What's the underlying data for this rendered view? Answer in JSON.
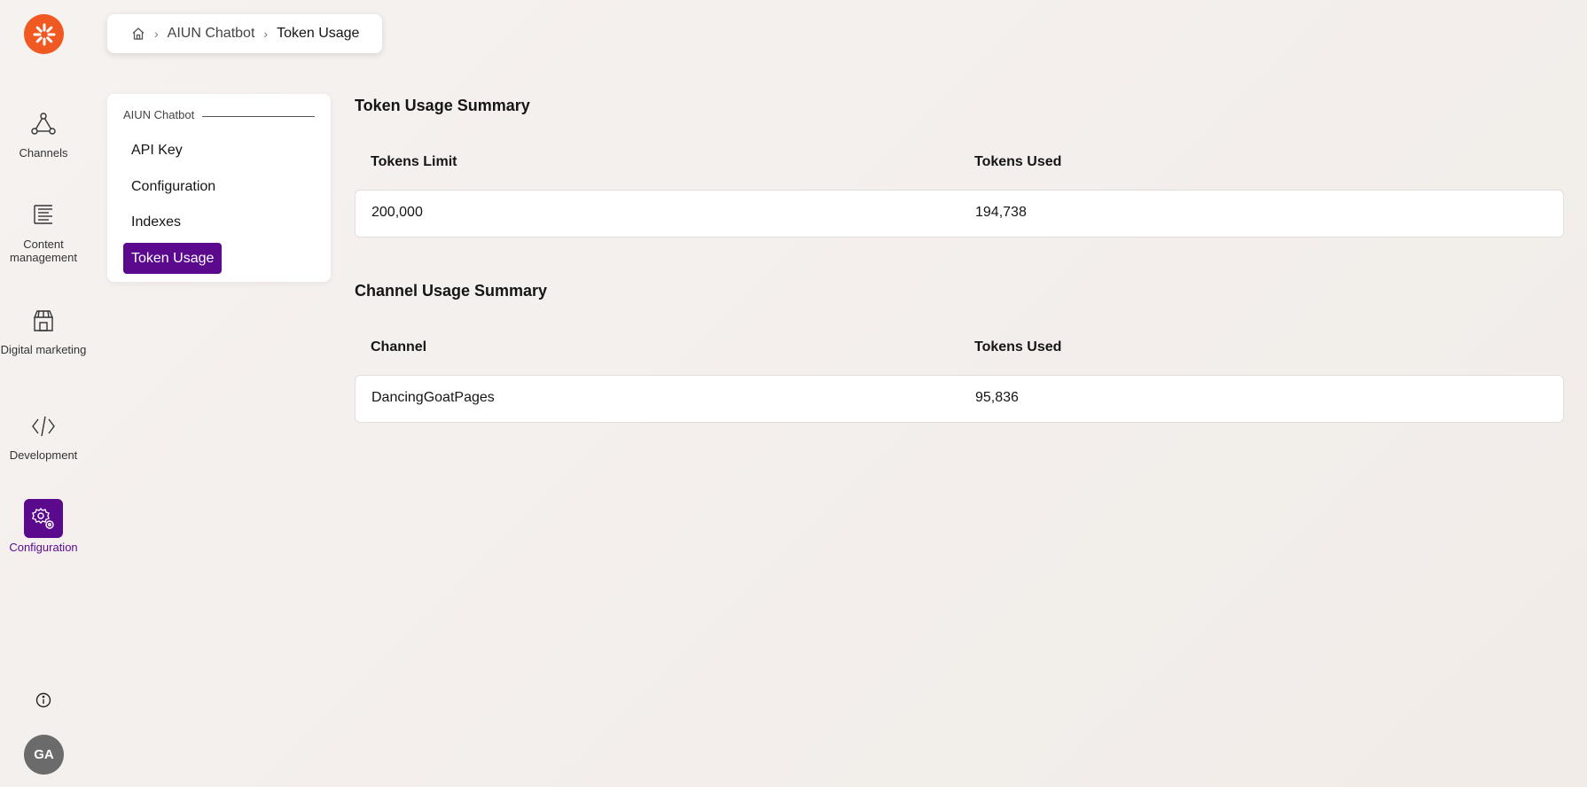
{
  "nav": {
    "items": [
      {
        "label": "Channels",
        "icon": "channels-icon"
      },
      {
        "label": "Content management",
        "icon": "content-management-icon"
      },
      {
        "label": "Digital marketing",
        "icon": "digital-marketing-icon"
      },
      {
        "label": "Development",
        "icon": "code-icon"
      },
      {
        "label": "Configuration",
        "icon": "gear-icon",
        "active": true
      }
    ],
    "avatar_initials": "GA",
    "accent_color": "#5b0a8e",
    "logo_color": "#f05a22"
  },
  "breadcrumb": {
    "home_icon": "home-icon",
    "items": [
      "AIUN Chatbot",
      "Token Usage"
    ]
  },
  "submenu": {
    "heading": "AIUN Chatbot",
    "items": [
      {
        "label": "API Key"
      },
      {
        "label": "Configuration"
      },
      {
        "label": "Indexes"
      },
      {
        "label": "Token Usage",
        "active": true
      }
    ]
  },
  "token_summary": {
    "title": "Token Usage Summary",
    "columns": [
      "Tokens Limit",
      "Tokens Used"
    ],
    "rows": [
      [
        "200,000",
        "194,738"
      ]
    ]
  },
  "channel_summary": {
    "title": "Channel Usage Summary",
    "columns": [
      "Channel",
      "Tokens Used"
    ],
    "rows": [
      [
        "DancingGoatPages",
        "95,836"
      ]
    ]
  }
}
